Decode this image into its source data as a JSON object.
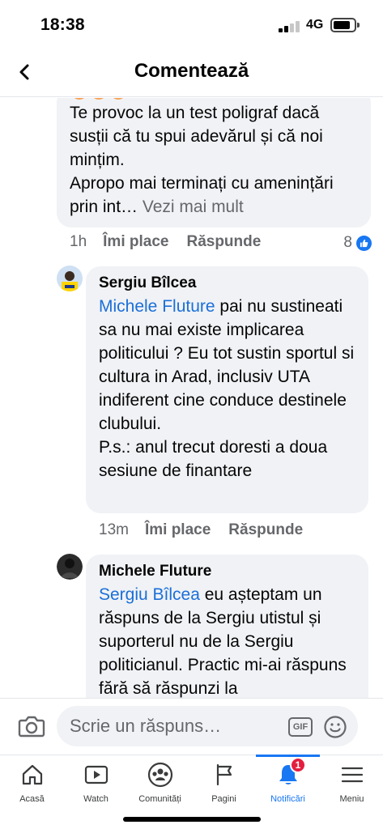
{
  "status_bar": {
    "time": "18:38",
    "network": "4G"
  },
  "header": {
    "title": "Comentează"
  },
  "comments": [
    {
      "text": "Te provoc la un test poligraf dacă susții că tu spui adevărul și că noi mințim.\nApropo mai terminați cu amenințări prin int…",
      "see_more": " Vezi mai mult",
      "time": "1h",
      "like_label": "Îmi place",
      "reply_label": "Răspunde",
      "like_count": "8"
    },
    {
      "author": "Sergiu Bîlcea",
      "mention": "Michele Fluture",
      "text": " pai nu sustineati sa nu mai existe implicarea politicului ? Eu tot sustin sportul si cultura in Arad, inclusiv UTA indiferent cine conduce destinele clubului.\nP.s.: anul trecut doresti a doua sesiune de finantare",
      "time": "13m",
      "like_label": "Îmi place",
      "reply_label": "Răspunde"
    },
    {
      "author": "Michele Fluture",
      "mention": "Sergiu Bîlcea",
      "text": " eu așteptam un răspuns de la Sergiu utistul și suporterul nu de la Sergiu politicianul. Practic mi-ai răspuns fără să răspunzi la"
    }
  ],
  "composer": {
    "placeholder": "Scrie un răspuns…",
    "gif_label": "GIF"
  },
  "bottom_nav": [
    {
      "label": "Acasă",
      "icon": "home-icon"
    },
    {
      "label": "Watch",
      "icon": "watch-icon"
    },
    {
      "label": "Comunități",
      "icon": "groups-icon"
    },
    {
      "label": "Pagini",
      "icon": "flag-icon"
    },
    {
      "label": "Notificări",
      "icon": "bell-icon",
      "badge": "1",
      "active": true
    },
    {
      "label": "Meniu",
      "icon": "menu-icon"
    }
  ],
  "colors": {
    "accent": "#1877f2",
    "bubble": "#f0f2f5",
    "badge": "#e41e3f",
    "mention": "#1b6fd8"
  }
}
